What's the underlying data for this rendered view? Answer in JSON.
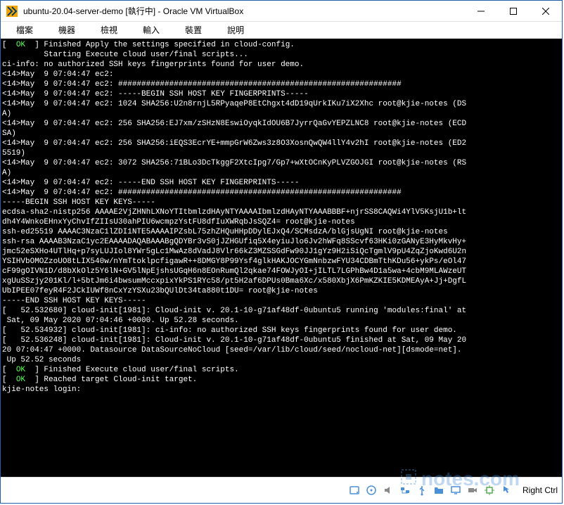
{
  "window": {
    "title": "ubuntu-20.04-server-demo [執行中] - Oracle VM VirtualBox"
  },
  "menubar": {
    "items": [
      "檔案",
      "機器",
      "檢視",
      "輸入",
      "裝置",
      "說明"
    ]
  },
  "terminal": {
    "lines": [
      {
        "segs": [
          {
            "t": "[  ",
            "c": "w"
          },
          {
            "t": "OK",
            "c": "g"
          },
          {
            "t": "  ] Finished ",
            "c": "w"
          },
          {
            "t": "Apply the settings specified in cloud-config.",
            "c": "w"
          }
        ]
      },
      {
        "segs": [
          {
            "t": "         Starting ",
            "c": "w"
          },
          {
            "t": "Execute cloud user/final scripts...",
            "c": "w"
          }
        ]
      },
      {
        "segs": [
          {
            "t": "ci-info: no authorized SSH keys fingerprints found for user demo.",
            "c": "w"
          }
        ]
      },
      {
        "segs": [
          {
            "t": "<14>May  9 07:04:47 ec2:",
            "c": "w"
          }
        ]
      },
      {
        "segs": [
          {
            "t": "<14>May  9 07:04:47 ec2: #############################################################",
            "c": "w"
          }
        ]
      },
      {
        "segs": [
          {
            "t": "<14>May  9 07:04:47 ec2: -----BEGIN SSH HOST KEY FINGERPRINTS-----",
            "c": "w"
          }
        ]
      },
      {
        "segs": [
          {
            "t": "<14>May  9 07:04:47 ec2: 1024 SHA256:U2n8rnjL5RPyaqeP8EtChgxt4dD19qUrkIKu7iX2Xhc root@kjie-notes (DS",
            "c": "w"
          }
        ]
      },
      {
        "segs": [
          {
            "t": "A)",
            "c": "w"
          }
        ]
      },
      {
        "segs": [
          {
            "t": "<14>May  9 07:04:47 ec2: 256 SHA256:EJ7xm/zSHzN8EswiOyqkIdOU6B7JyrrQaGvYEPZLNC8 root@kjie-notes (ECD",
            "c": "w"
          }
        ]
      },
      {
        "segs": [
          {
            "t": "SA)",
            "c": "w"
          }
        ]
      },
      {
        "segs": [
          {
            "t": "<14>May  9 07:04:47 ec2: 256 SHA256:iEQS3EcrYE+mmpGrW6Zws3z8O3XosnQwQW4llY4v2hI root@kjie-notes (ED2",
            "c": "w"
          }
        ]
      },
      {
        "segs": [
          {
            "t": "5519)",
            "c": "w"
          }
        ]
      },
      {
        "segs": [
          {
            "t": "<14>May  9 07:04:47 ec2: 3072 SHA256:71BLo3DcTkggF2XtcIpg7/Gp7+wXtOCnKyPLVZGOJGI root@kjie-notes (RS",
            "c": "w"
          }
        ]
      },
      {
        "segs": [
          {
            "t": "A)",
            "c": "w"
          }
        ]
      },
      {
        "segs": [
          {
            "t": "<14>May  9 07:04:47 ec2: -----END SSH HOST KEY FINGERPRINTS-----",
            "c": "w"
          }
        ]
      },
      {
        "segs": [
          {
            "t": "<14>May  9 07:04:47 ec2: #############################################################",
            "c": "w"
          }
        ]
      },
      {
        "segs": [
          {
            "t": "-----BEGIN SSH HOST KEY KEYS-----",
            "c": "w"
          }
        ]
      },
      {
        "segs": [
          {
            "t": "ecdsa-sha2-nistp256 AAAAE2VjZHNhLXNoYTItbmlzdHAyNTYAAAAIbmlzdHAyNTYAAABBBF+njrSS8CAQWi4YlV5KsjU1b+lt",
            "c": "w"
          }
        ]
      },
      {
        "segs": [
          {
            "t": "dh4Y4WnkoEHnxYyChvIfZIIsU30ahPIU6wcmpzYstFU8dfIuXWRqbJsSQZ4= root@kjie-notes",
            "c": "w"
          }
        ]
      },
      {
        "segs": [
          {
            "t": "ssh-ed25519 AAAAC3NzaC1lZDI1NTE5AAAAIPZsbL75zhZHQuHHpDDylEJxQ4/SCMsdzA/blGjsUgNI root@kjie-notes",
            "c": "w"
          }
        ]
      },
      {
        "segs": [
          {
            "t": "ssh-rsa AAAAB3NzaC1yc2EAAAADAQABAAABgQDYBr3vS0jJZHGUfiq5X4eyiuJlo6Jv2hWFq8SScvf63HKi0zGANyE3HyMkvHy+",
            "c": "w"
          }
        ]
      },
      {
        "segs": [
          {
            "t": "jmc52eSXHo4UTlHq+p7syLUJIol8YWr5gLc1MwAz8dVadJ8Vlr66kZ3MZSSGdFw90JJ1gYz9H2iSiQcTgmlV9pU4ZqZjoKwd6U2n",
            "c": "w"
          }
        ]
      },
      {
        "segs": [
          {
            "t": "YSIHVbOMOZzoUO8tLIX540w/nYmTtoklpcfigawR++8DMGY8P99Ysf4glkHAKJOCYGmNnbzwFYU34CDBmTthKDu56+ykPs/eOl47",
            "c": "w"
          }
        ]
      },
      {
        "segs": [
          {
            "t": "cF99gOIVN1D/d8bXkOlz5Y6lN+GV5lNpEjshsUGqH6n8EOnRumQl2qkae74FOWJyOI+jILTL7LGPhBw4D1a5wa+4cbM9MLAWzeUT",
            "c": "w"
          }
        ]
      },
      {
        "segs": [
          {
            "t": "xgUuSSzjy201Kl/l+5btJm6i4bwsumMccxpixYkPS1RYc58/pt5H2af6DPUs0Bma6Xc/x580XbjX6PmKZKIE5KDMEAyA+Jj+DgfL",
            "c": "w"
          }
        ]
      },
      {
        "segs": [
          {
            "t": "UbIPEE07feyR4F2JCkIUWf8nCxYzYSXu23bQUlDt34ta880t1DU= root@kjie-notes",
            "c": "w"
          }
        ]
      },
      {
        "segs": [
          {
            "t": "-----END SSH HOST KEY KEYS-----",
            "c": "w"
          }
        ]
      },
      {
        "segs": [
          {
            "t": "[   52.532680] cloud-init[1981]: Cloud-init v. 20.1-10-g71af48df-0ubuntu5 running 'modules:final' at",
            "c": "w"
          }
        ]
      },
      {
        "segs": [
          {
            "t": " Sat, 09 May 2020 07:04:46 +0000. Up 52.28 seconds.",
            "c": "w"
          }
        ]
      },
      {
        "segs": [
          {
            "t": "[   52.534932] cloud-init[1981]: ci-info: no authorized SSH keys fingerprints found for user demo.",
            "c": "w"
          }
        ]
      },
      {
        "segs": [
          {
            "t": "[   52.536248] cloud-init[1981]: Cloud-init v. 20.1-10-g71af48df-0ubuntu5 finished at Sat, 09 May 20",
            "c": "w"
          }
        ]
      },
      {
        "segs": [
          {
            "t": "20 07:04:47 +0000. Datasource DataSourceNoCloud [seed=/var/lib/cloud/seed/nocloud-net][dsmode=net].",
            "c": "w"
          }
        ]
      },
      {
        "segs": [
          {
            "t": " Up 52.52 seconds",
            "c": "w"
          }
        ]
      },
      {
        "segs": [
          {
            "t": "[  ",
            "c": "w"
          },
          {
            "t": "OK",
            "c": "g"
          },
          {
            "t": "  ] Finished ",
            "c": "w"
          },
          {
            "t": "Execute cloud user/final scripts.",
            "c": "w"
          }
        ]
      },
      {
        "segs": [
          {
            "t": "[  ",
            "c": "w"
          },
          {
            "t": "OK",
            "c": "g"
          },
          {
            "t": "  ] Reached target ",
            "c": "w"
          },
          {
            "t": "Cloud-init target.",
            "c": "w"
          }
        ]
      },
      {
        "segs": [
          {
            "t": "",
            "c": "w"
          }
        ]
      },
      {
        "segs": [
          {
            "t": "kjie-notes login: ",
            "c": "w"
          }
        ]
      }
    ]
  },
  "statusbar": {
    "host_key": "Right Ctrl"
  },
  "watermark": {
    "text": "notes.com"
  }
}
